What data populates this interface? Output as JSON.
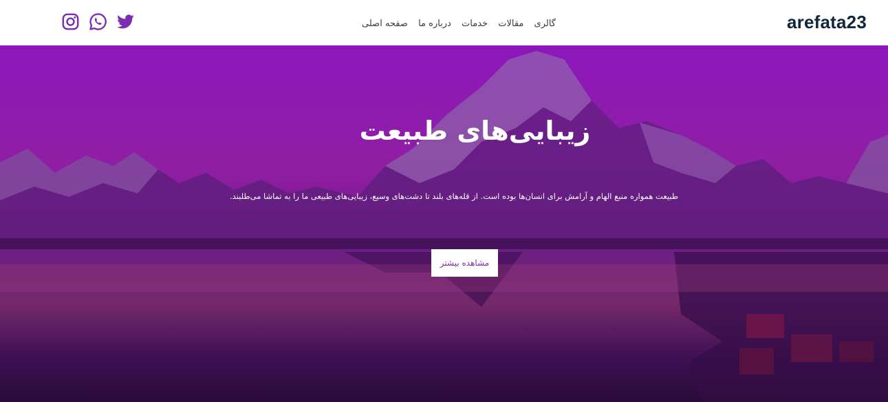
{
  "header": {
    "brand": "arefata23",
    "nav": [
      {
        "label": "صفحه اصلی"
      },
      {
        "label": "درباره ما"
      },
      {
        "label": "خدمات"
      },
      {
        "label": "مقالات"
      },
      {
        "label": "گالری"
      }
    ],
    "socials": [
      {
        "name": "instagram-icon"
      },
      {
        "name": "whatsapp-icon"
      },
      {
        "name": "twitter-icon"
      }
    ]
  },
  "hero": {
    "title": "زیبایی‌های طبیعت",
    "text": "طبیعت همواره منبع الهام و آرامش برای انسان‌ها بوده است. از قله‌های بلند تا دشت‌های وسیع، زیبایی‌های طبیعی ما را به تماشا می‌طلبند.",
    "button_label": "مشاهده بیشتر"
  },
  "colors": {
    "brand_text": "#10263d",
    "icon_purple": "#7b2fb0",
    "overlay_top": "#8a1bb5",
    "button_text": "#7a2ea0"
  }
}
